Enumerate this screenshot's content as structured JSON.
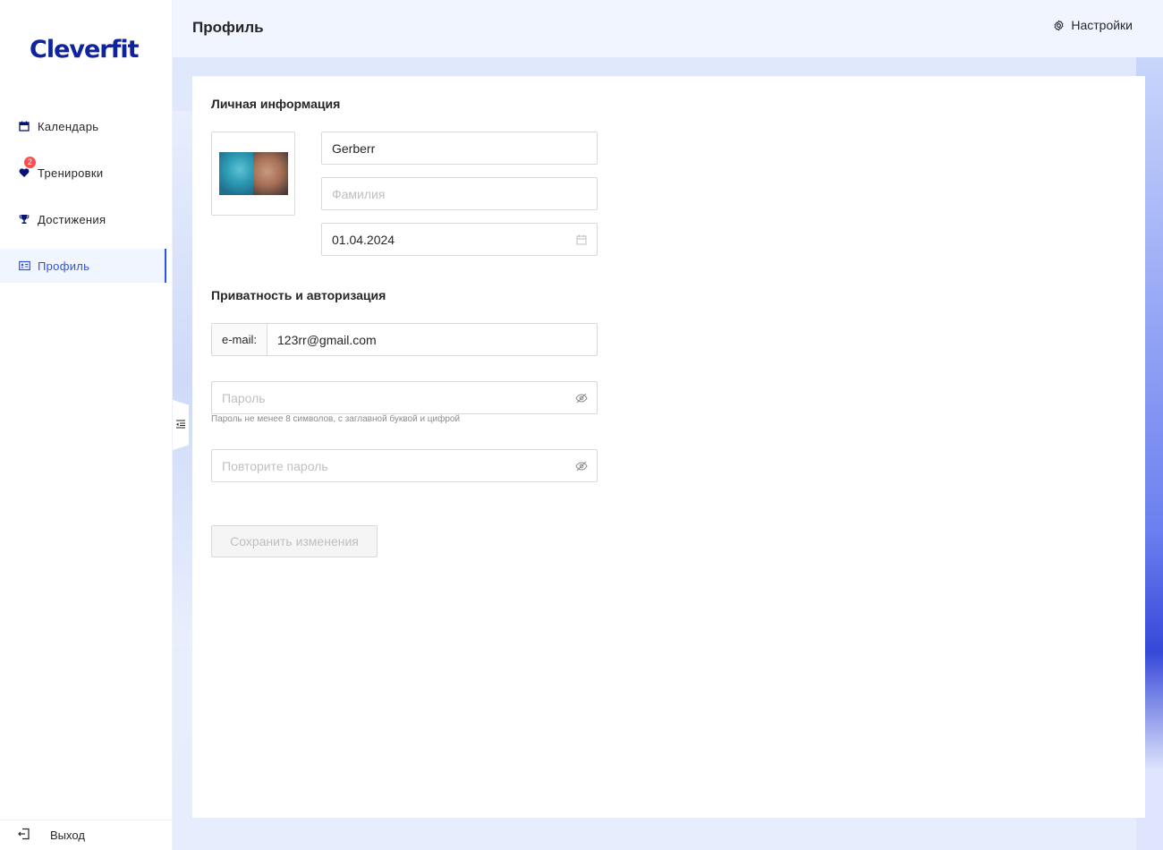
{
  "app": {
    "logo": "Cleverfit"
  },
  "sidebar": {
    "items": [
      {
        "label": "Календарь",
        "icon": "calendar-icon"
      },
      {
        "label": "Тренировки",
        "icon": "heart-icon",
        "badge": "2"
      },
      {
        "label": "Достижения",
        "icon": "trophy-icon"
      },
      {
        "label": "Профиль",
        "icon": "idcard-icon",
        "active": true
      }
    ],
    "logout": "Выход"
  },
  "header": {
    "title": "Профиль",
    "settings": "Настройки"
  },
  "profile": {
    "section_personal": "Личная информация",
    "first_name": {
      "value": "Gerberr"
    },
    "last_name": {
      "placeholder": "Фамилия"
    },
    "birthday": {
      "value": "01.04.2024"
    },
    "section_privacy": "Приватность и авторизация",
    "email": {
      "addon": "e-mail:",
      "value": "123rr@gmail.com"
    },
    "password": {
      "placeholder": "Пароль",
      "hint": "Пароль не менее 8 символов, с заглавной буквой и цифрой"
    },
    "password_repeat": {
      "placeholder": "Повторите пароль"
    },
    "save_label": "Сохранить изменения"
  },
  "colors": {
    "brand": "#10239e",
    "accent": "#2f54eb",
    "badge": "#ff4d4f",
    "header_bg": "#f0f5ff"
  }
}
